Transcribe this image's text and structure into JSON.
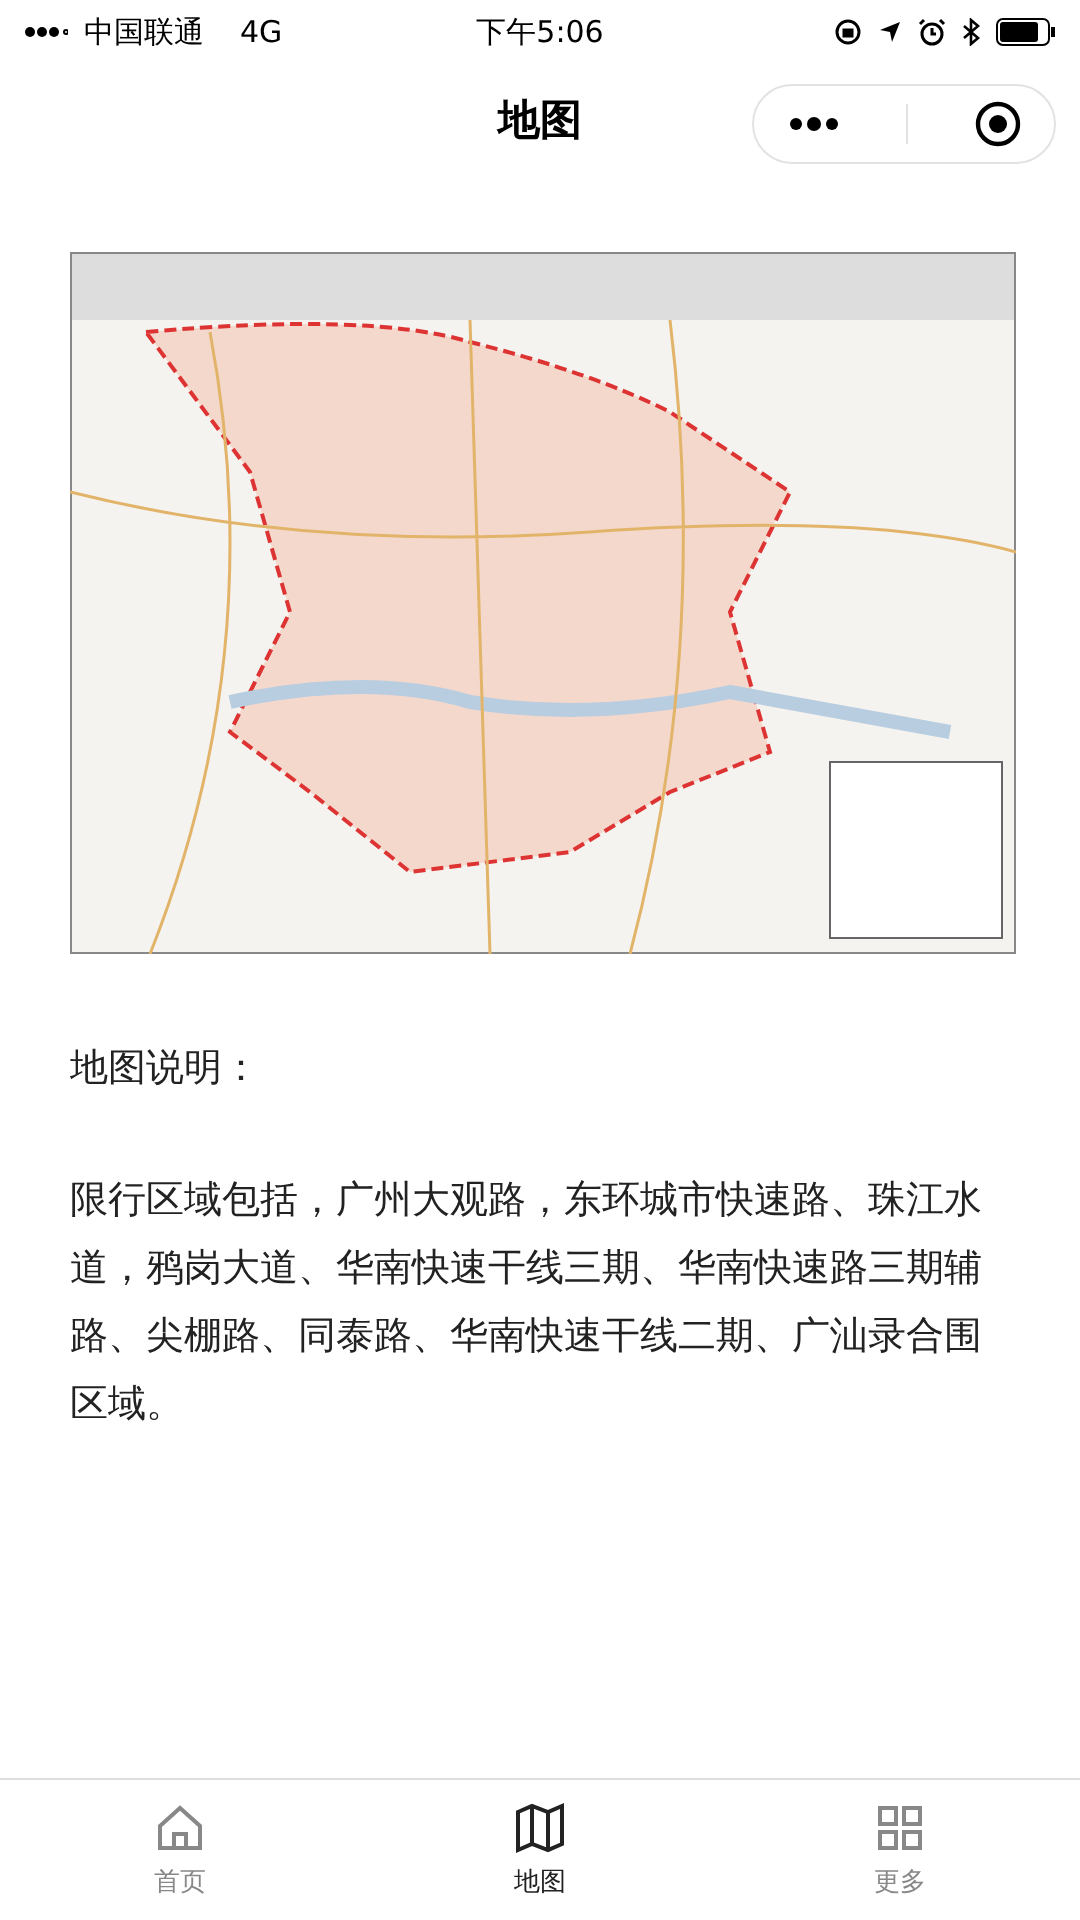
{
  "status_bar": {
    "carrier": "中国联通",
    "network": "4G",
    "time": "下午5:06"
  },
  "nav_bar": {
    "title": "地图"
  },
  "heading": "地图说明：",
  "description": "限行区域包括，广州大观路，东环城市快速路、珠江水道，鸦岗大道、华南快速干线三期、华南快速路三期辅路、尖棚路、同泰路、华南快速干线二期、广汕录合围区域。",
  "tab_bar": [
    {
      "kind": "home",
      "label": "首页",
      "selected": false
    },
    {
      "kind": "map",
      "label": "地图",
      "selected": true
    },
    {
      "kind": "more",
      "label": "更多",
      "selected": false
    }
  ]
}
